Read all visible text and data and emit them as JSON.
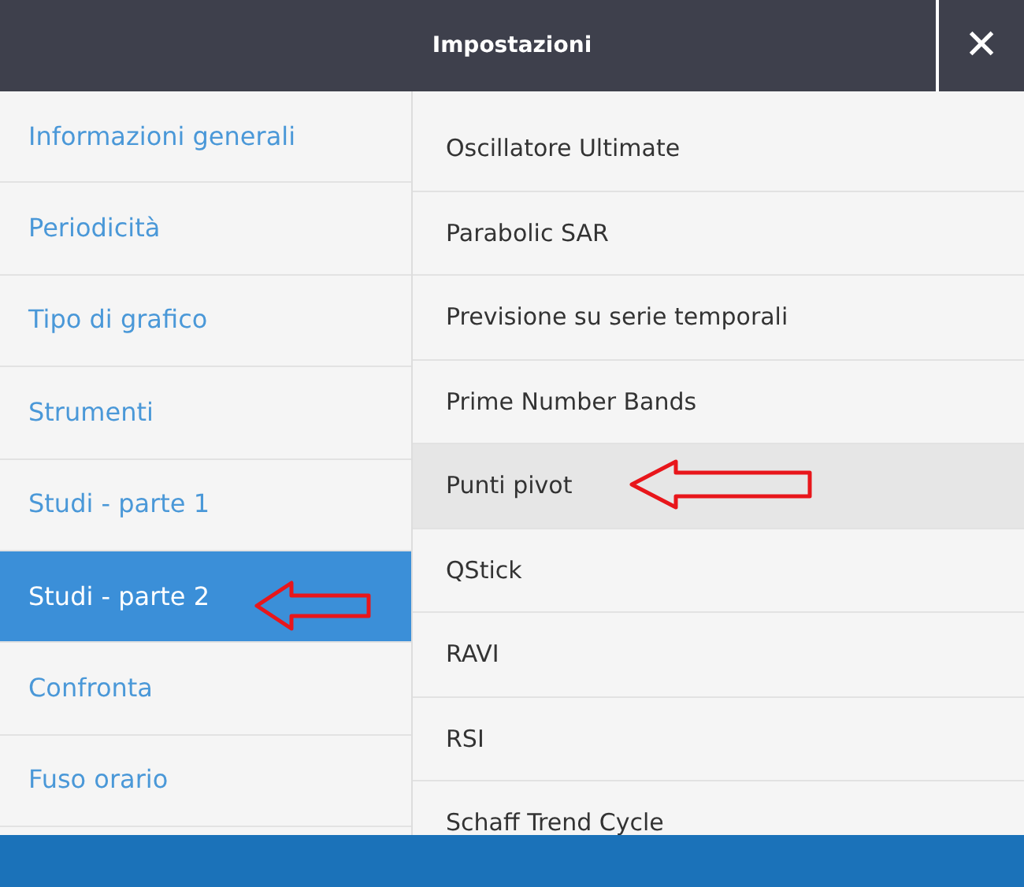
{
  "header": {
    "title": "Impostazioni",
    "close": "✕"
  },
  "categories": [
    {
      "label": "Informazioni generali",
      "selected": false
    },
    {
      "label": "Periodicità",
      "selected": false
    },
    {
      "label": "Tipo di grafico",
      "selected": false
    },
    {
      "label": "Strumenti",
      "selected": false
    },
    {
      "label": "Studi - parte 1",
      "selected": false
    },
    {
      "label": "Studi - parte 2",
      "selected": true
    },
    {
      "label": "Confronta",
      "selected": false
    },
    {
      "label": "Fuso orario",
      "selected": false
    }
  ],
  "studies": [
    {
      "label": "Oscillatore Ultimate",
      "highlighted": false
    },
    {
      "label": "Parabolic SAR",
      "highlighted": false
    },
    {
      "label": "Previsione su serie temporali",
      "highlighted": false
    },
    {
      "label": "Prime Number Bands",
      "highlighted": false
    },
    {
      "label": "Punti pivot",
      "highlighted": true
    },
    {
      "label": "QStick",
      "highlighted": false
    },
    {
      "label": "RAVI",
      "highlighted": false
    },
    {
      "label": "RSI",
      "highlighted": false
    },
    {
      "label": "Schaff Trend Cycle",
      "highlighted": false
    }
  ]
}
